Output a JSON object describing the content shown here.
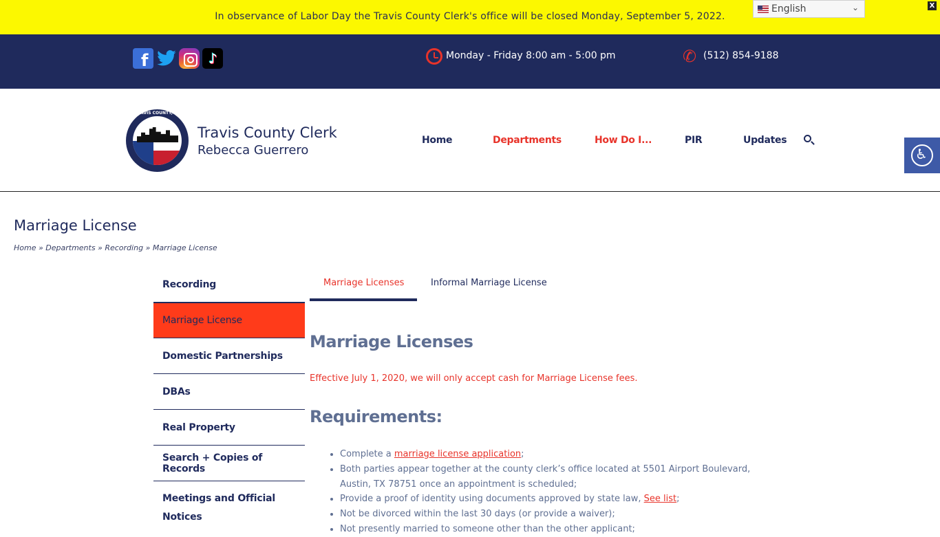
{
  "notice": {
    "text": "In observance of Labor Day the Travis County Clerk's office will be closed Monday, September 5, 2022.",
    "close_label": "X"
  },
  "language": {
    "selected": "English"
  },
  "topbar": {
    "social": [
      "facebook-icon",
      "twitter-icon",
      "instagram-icon",
      "tiktok-icon"
    ],
    "hours": "Monday - Friday 8:00 am - 5:00 pm",
    "phone": "(512) 854-9188"
  },
  "header": {
    "title": "Travis County Clerk",
    "subtitle": "Rebecca Guerrero",
    "logo_text": "TRAVIS COUNTY, TX",
    "nav": {
      "home": "Home",
      "departments": "Departments",
      "how": "How Do I...",
      "pir": "PIR",
      "updates": "Updates"
    }
  },
  "page": {
    "title": "Marriage License",
    "breadcrumb": "Home » Departments » Recording » Marriage License"
  },
  "sidebar": {
    "items": [
      "Recording",
      "Marriage License",
      "Domestic Partnerships",
      "DBAs",
      "Real Property",
      "Search + Copies of Records",
      "Meetings and Official Notices"
    ]
  },
  "tabs": {
    "marriage": "Marriage Licenses",
    "informal": "Informal Marriage License"
  },
  "content": {
    "heading": "Marriage Licenses",
    "notice": "Effective July 1, 2020, we will only accept cash for Marriage License fees.",
    "req_heading": "Requirements:",
    "req1_pre": "Complete a ",
    "req1_link": "marriage license application",
    "req1_post": ";",
    "req2": "Both parties appear together at the county clerk’s office located at 5501 Airport Boulevard, Austin, TX 78751 once an appointment is scheduled;",
    "req3_pre": "Provide a proof of identity using documents approved by state law, ",
    "req3_link": "See list",
    "req3_post": ";",
    "req4": "Not be divorced within the last 30 days (or provide a waiver);",
    "req5": "Not presently married to someone other than the other applicant;"
  },
  "colors": {
    "navy": "#1f2a5c",
    "accent_red": "#e8332a",
    "notice_yellow": "#fcf800",
    "active_orange": "#ff3b1a"
  }
}
